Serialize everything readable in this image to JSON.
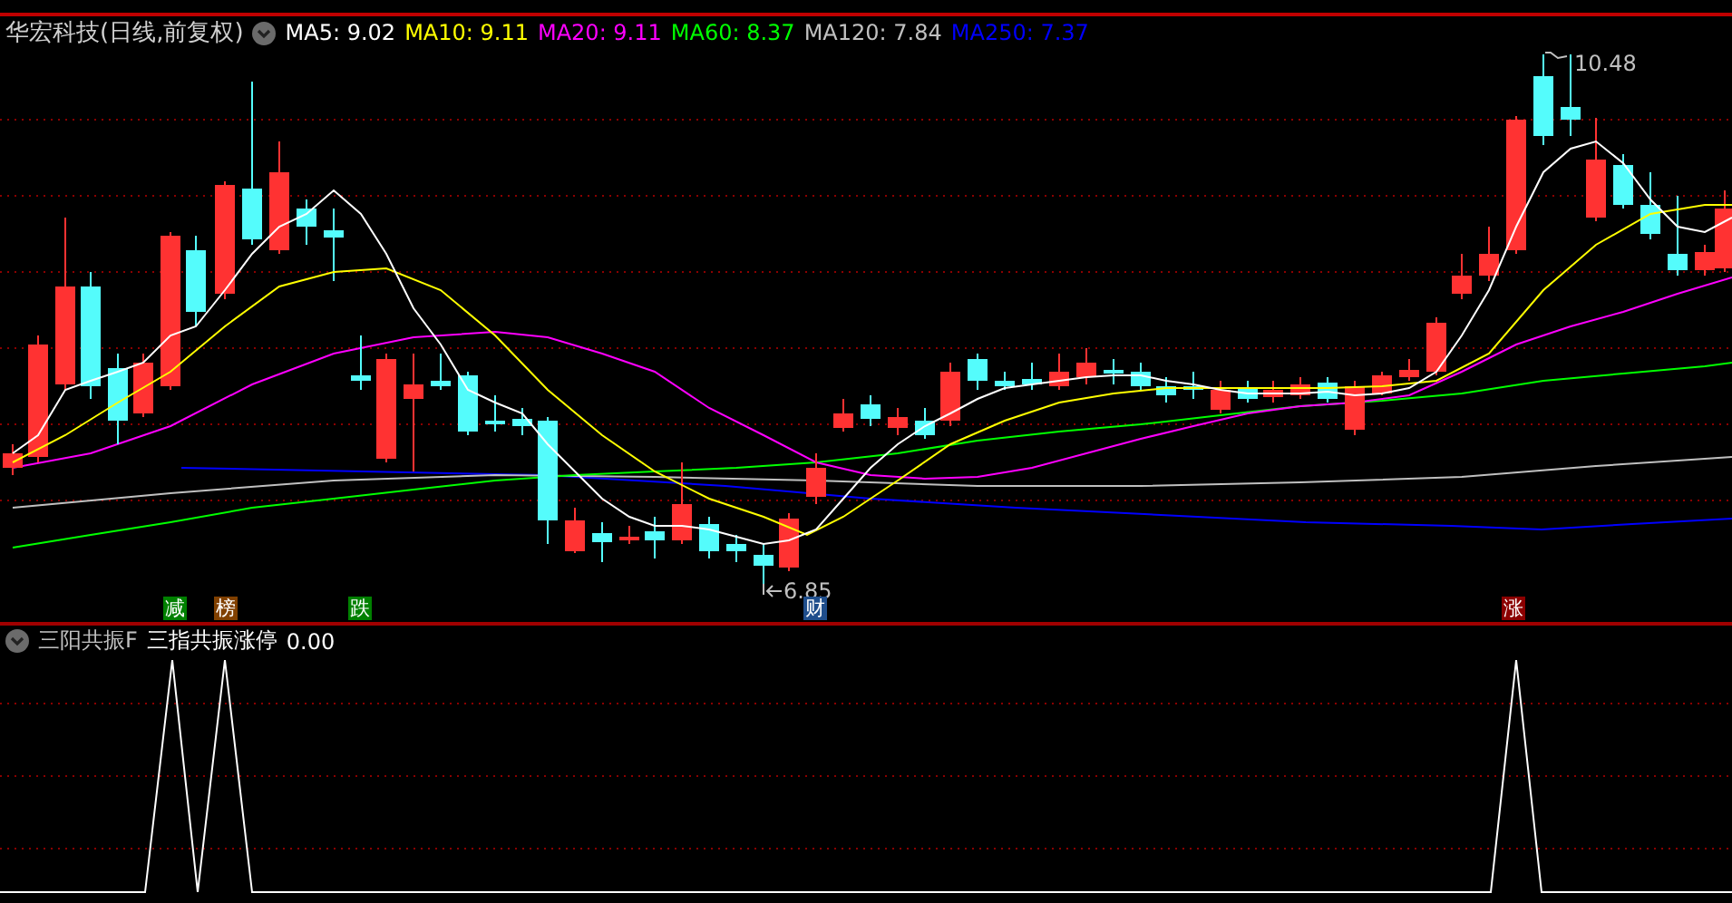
{
  "main_chart": {
    "title": "华宏科技(日线,前复权)",
    "indicators": [
      {
        "text": "MA5: 9.02",
        "color": "#ffffff"
      },
      {
        "text": "MA10: 9.11",
        "color": "#ffff00"
      },
      {
        "text": "MA20: 9.11",
        "color": "#ff00ff"
      },
      {
        "text": "MA60: 8.37",
        "color": "#00ff00"
      },
      {
        "text": "MA120: 7.84",
        "color": "#c0c0c0"
      },
      {
        "text": "MA250: 7.37",
        "color": "#0000ff"
      }
    ],
    "price_labels": [
      {
        "kind": "high",
        "text": "10.48"
      },
      {
        "kind": "low",
        "text": "6.85"
      }
    ],
    "event_tags": [
      {
        "text": "减",
        "color": "#008000"
      },
      {
        "text": "榜",
        "color": "#804000"
      },
      {
        "text": "跌",
        "color": "#008000"
      },
      {
        "text": "财",
        "color": "#1f4e8c"
      },
      {
        "text": "涨",
        "color": "#8b0000"
      }
    ]
  },
  "indicator_panel": {
    "title": "三阳共振F",
    "indicator": "三指共振涨停",
    "value": "0.00"
  }
}
